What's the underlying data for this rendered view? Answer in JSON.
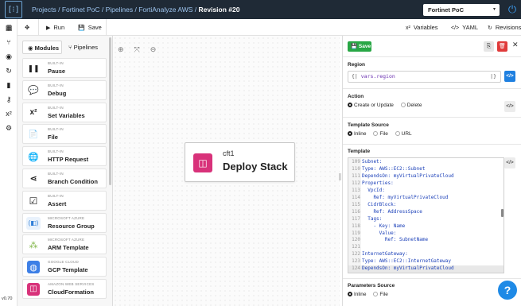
{
  "topbar": {
    "logo_glyph": "[⁝]",
    "breadcrumb": [
      "Projects",
      "Fortinet PoC",
      "Pipelines",
      "FortiAnalyze AWS"
    ],
    "current": "Revision #20",
    "org_selector": "Fortinet PoC",
    "org_caret": "▾",
    "power_icon": "⏻"
  },
  "rail": {
    "icons": [
      "grid-icon",
      "pipelines-icon",
      "dashboard-icon",
      "history-icon",
      "bolt-icon",
      "key-icon",
      "variables-icon",
      "gear-icon"
    ],
    "glyphs": [
      "▦",
      "⑂",
      "◉",
      "↻",
      "▮",
      "⚷",
      "x²",
      "⚙"
    ],
    "version": "v0.70"
  },
  "toolbar": {
    "menu_glyph": "☰",
    "wand_glyph": "✥",
    "run_label": "Run",
    "run_glyph": "▶",
    "save_label": "Save",
    "save_glyph": "💾",
    "variables_label": "Variables",
    "variables_glyph": "x²",
    "yaml_label": "YAML",
    "yaml_glyph": "</>",
    "revisions_label": "Revisions",
    "revisions_glyph": "↻"
  },
  "modules_panel": {
    "tabs": [
      {
        "label": "Modules",
        "glyph": "◉",
        "active": true
      },
      {
        "label": "Pipelines",
        "glyph": "⑂",
        "active": false
      }
    ],
    "items": [
      {
        "category": "BUILT-IN",
        "name": "Pause",
        "icon": "pause-icon",
        "glyph": "❚❚"
      },
      {
        "category": "BUILT-IN",
        "name": "Debug",
        "icon": "speech-bubble-icon",
        "glyph": "💬"
      },
      {
        "category": "BUILT-IN",
        "name": "Set Variables",
        "icon": "variables-icon",
        "glyph": "x²"
      },
      {
        "category": "BUILT-IN",
        "name": "File",
        "icon": "file-icon",
        "glyph": "📄"
      },
      {
        "category": "BUILT-IN",
        "name": "HTTP Request",
        "icon": "globe-icon",
        "glyph": "🌐"
      },
      {
        "category": "BUILT-IN",
        "name": "Branch Condition",
        "icon": "share-icon",
        "glyph": "⋖"
      },
      {
        "category": "BUILT-IN",
        "name": "Assert",
        "icon": "checkbox-icon",
        "glyph": "☑"
      },
      {
        "category": "MICROSOFT AZURE",
        "name": "Resource Group",
        "icon": "resource-group-icon",
        "glyph": "(◧)"
      },
      {
        "category": "MICROSOFT AZURE",
        "name": "ARM Template",
        "icon": "arm-template-icon",
        "glyph": "⁂"
      },
      {
        "category": "GOOGLE CLOUD",
        "name": "GCP Template",
        "icon": "gcp-template-icon",
        "glyph": "◍"
      },
      {
        "category": "AMAZON WEB SERVICES",
        "name": "CloudFormation",
        "icon": "cloudformation-icon",
        "glyph": "◫"
      }
    ]
  },
  "canvas": {
    "zoom_in_glyph": "⊕",
    "fit_glyph": "⤧",
    "zoom_out_glyph": "⊖",
    "node": {
      "id": "cft1",
      "title": "Deploy Stack",
      "glyph": "◫"
    }
  },
  "right_panel": {
    "save_label": "Save",
    "save_glyph": "💾",
    "duplicate_glyph": "⎘",
    "delete_glyph": "🗑",
    "close_glyph": "✕",
    "region": {
      "label": "Region",
      "value": "vars.region",
      "open": "{|",
      "close": "|}",
      "code_glyph": "</>"
    },
    "action": {
      "label": "Action",
      "options": [
        {
          "label": "Create or Update",
          "selected": true
        },
        {
          "label": "Delete",
          "selected": false
        }
      ]
    },
    "template_source": {
      "label": "Template Source",
      "options": [
        {
          "label": "Inline",
          "selected": true
        },
        {
          "label": "File",
          "selected": false
        },
        {
          "label": "URL",
          "selected": false
        }
      ]
    },
    "template": {
      "label": "Template",
      "lines": [
        {
          "n": "109",
          "t": "Subnet:",
          "cls": "k"
        },
        {
          "n": "110",
          "t": "Type: AWS::EC2::Subnet",
          "cls": "k"
        },
        {
          "n": "111",
          "t": "DependsOn: myVirtualPrivateCloud",
          "cls": "k"
        },
        {
          "n": "112",
          "t": "Properties:",
          "cls": "k"
        },
        {
          "n": "113",
          "t": "  VpcId:",
          "cls": "k"
        },
        {
          "n": "114",
          "t": "    Ref: myVirtualPrivateCloud",
          "cls": "k"
        },
        {
          "n": "115",
          "t": "  CidrBlock:",
          "cls": "k"
        },
        {
          "n": "116",
          "t": "    Ref: AddressSpace",
          "cls": "k"
        },
        {
          "n": "117",
          "t": "  Tags:",
          "cls": "k"
        },
        {
          "n": "118",
          "t": "    - Key: Name",
          "cls": "k"
        },
        {
          "n": "119",
          "t": "      Value:",
          "cls": "k"
        },
        {
          "n": "120",
          "t": "        Ref: SubnetName",
          "cls": "k"
        },
        {
          "n": "121",
          "t": "",
          "cls": "k"
        },
        {
          "n": "122",
          "t": "InternetGateway:",
          "cls": "k"
        },
        {
          "n": "123",
          "t": "Type: AWS::EC2::InternetGateway",
          "cls": "k"
        },
        {
          "n": "124",
          "t": "DependsOn: myVirtualPrivateCloud",
          "cls": "k",
          "hl": true
        }
      ]
    },
    "parameters_source": {
      "label": "Parameters Source",
      "options": [
        {
          "label": "Inline",
          "selected": true
        },
        {
          "label": "File",
          "selected": false
        }
      ]
    }
  },
  "help_glyph": "?",
  "colors": {
    "accent": "#1f80e0",
    "save_green": "#28a745",
    "delete_red": "#e03b3b",
    "node_pink": "#d8327a",
    "topbar": "#1f2a36"
  }
}
